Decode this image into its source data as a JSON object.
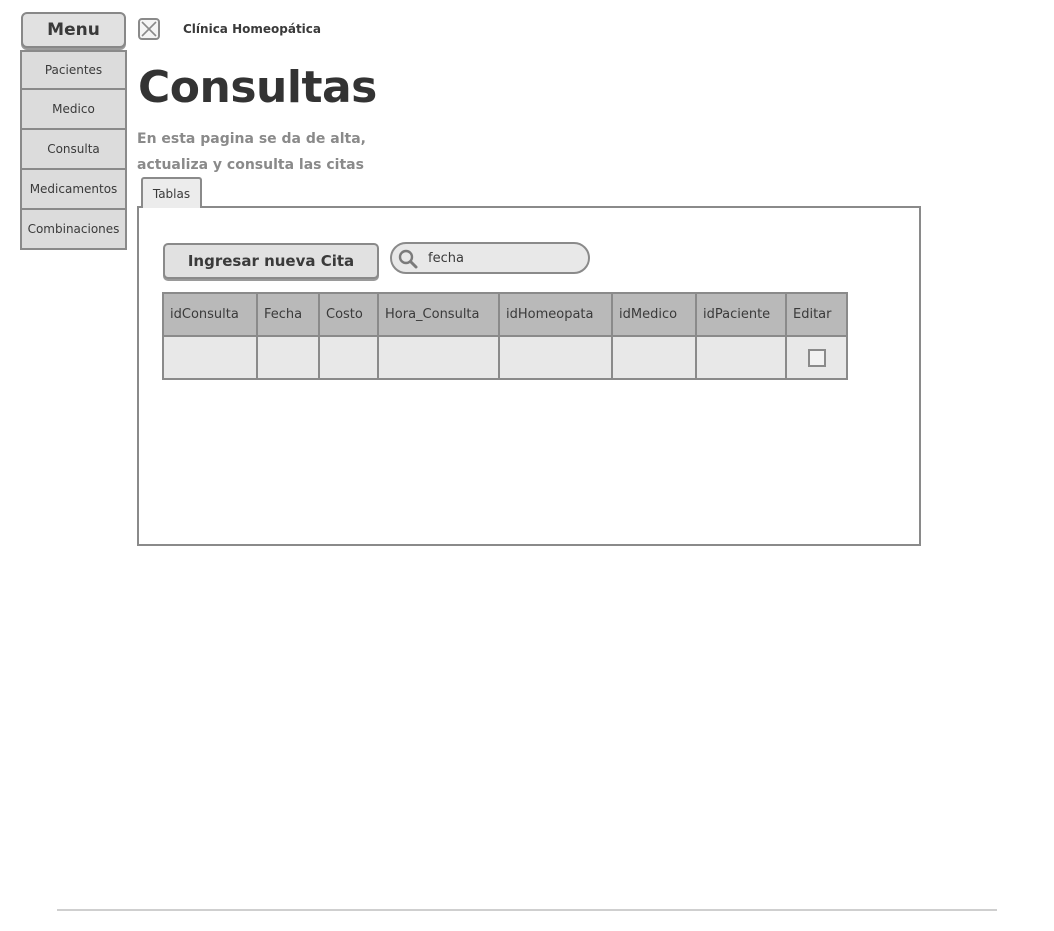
{
  "menu": {
    "title": "Menu",
    "items": [
      {
        "label": "Pacientes"
      },
      {
        "label": "Medico"
      },
      {
        "label": "Consulta"
      },
      {
        "label": "Medicamentos"
      },
      {
        "label": "Combinaciones"
      }
    ]
  },
  "header": {
    "logo_icon": "image-placeholder-icon",
    "clinic_name": "Clínica Homeopática",
    "title": "Consultas",
    "description": "En esta pagina se da de alta, actualiza y consulta las citas"
  },
  "tabs": [
    {
      "label": "Tablas"
    }
  ],
  "toolbar": {
    "new_button_label": "Ingresar nueva Cita",
    "search_value": "fecha",
    "search_icon": "search-icon"
  },
  "table": {
    "columns": [
      "idConsulta",
      "Fecha",
      "Costo",
      "Hora_Consulta",
      "idHomeopata",
      "idMedico",
      "idPaciente",
      "Editar"
    ],
    "rows": [
      [
        "",
        "",
        "",
        "",
        "",
        "",
        "",
        ""
      ]
    ]
  },
  "colors": {
    "button_bg": "#e1e1e1",
    "header_bg": "#b9b9b9",
    "cell_bg": "#e8e8e8",
    "border": "#8a8a8a"
  }
}
